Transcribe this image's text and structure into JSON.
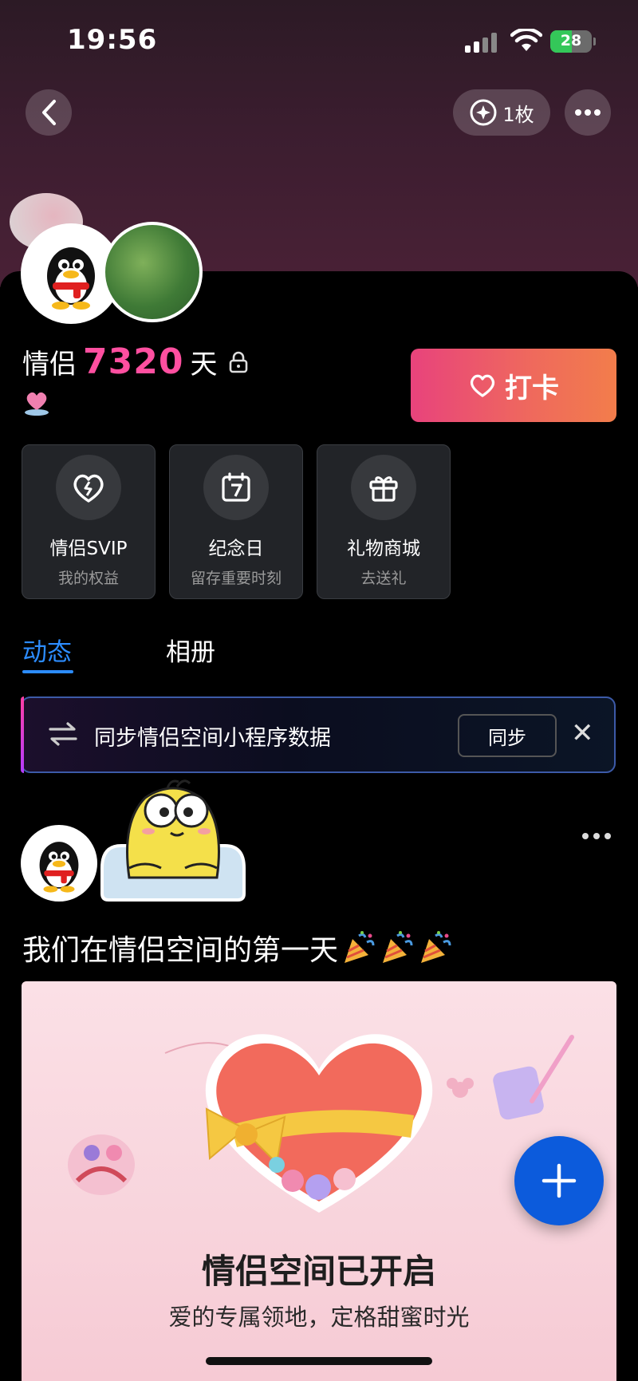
{
  "status_bar": {
    "time": "19:56",
    "battery": "28"
  },
  "header": {
    "coin_label": "1枚"
  },
  "couple": {
    "prefix": "情侣",
    "days": "7320",
    "suffix": "天",
    "checkin_label": "打卡"
  },
  "cards": [
    {
      "title": "情侣SVIP",
      "subtitle": "我的权益",
      "icon": "heart-broken-icon"
    },
    {
      "title": "纪念日",
      "subtitle": "留存重要时刻",
      "icon": "calendar-7-icon"
    },
    {
      "title": "礼物商城",
      "subtitle": "去送礼",
      "icon": "gift-icon"
    }
  ],
  "tabs": [
    {
      "label": "动态",
      "active": true
    },
    {
      "label": "相册",
      "active": false
    }
  ],
  "sync": {
    "text": "同步情侣空间小程序数据",
    "button_label": "同步"
  },
  "post": {
    "text": "我们在情侣空间的第一天"
  },
  "banner": {
    "title": "情侣空间已开启",
    "subtitle": "爱的专属领地，定格甜蜜时光"
  },
  "colors": {
    "accent_blue": "#2c8cff",
    "days_pink": "#ff4fa0",
    "checkin_gradient_start": "#e8437c",
    "checkin_gradient_end": "#f27d4b",
    "fab_blue": "#0c5bdc"
  }
}
